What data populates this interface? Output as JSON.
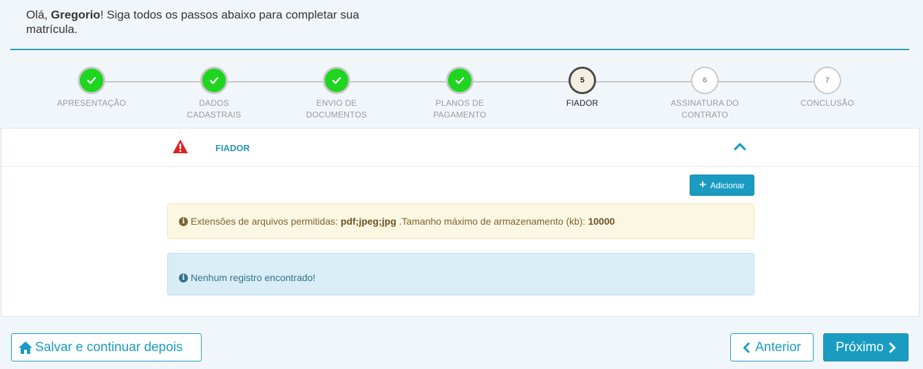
{
  "greeting": {
    "prefix": "Olá, ",
    "name": "Gregorio",
    "suffix": "! Siga todos os passos abaixo para completar sua matrícula."
  },
  "stepper": {
    "steps": [
      {
        "label_line1": "APRESENTAÇÃO",
        "label_line2": "",
        "status": "done",
        "number": ""
      },
      {
        "label_line1": "DADOS",
        "label_line2": "CADASTRAIS",
        "status": "done",
        "number": ""
      },
      {
        "label_line1": "ENVIO DE",
        "label_line2": "DOCUMENTOS",
        "status": "done",
        "number": ""
      },
      {
        "label_line1": "PLANOS DE",
        "label_line2": "PAGAMENTO",
        "status": "done",
        "number": ""
      },
      {
        "label_line1": "FIADOR",
        "label_line2": "",
        "status": "current",
        "number": "5"
      },
      {
        "label_line1": "ASSINATURA DO",
        "label_line2": "CONTRATO",
        "status": "pending",
        "number": "6"
      },
      {
        "label_line1": "CONCLUSÃO",
        "label_line2": "",
        "status": "pending",
        "number": "7"
      }
    ]
  },
  "panel": {
    "title": "FIADOR",
    "add_button_label": "Adicionar",
    "warning": {
      "text_before": "Extensões de arquivos permitidas: ",
      "extensions": "pdf;jpeg;jpg",
      "text_middle": " .Tamanho máximo de armazenamento (kb): ",
      "max_size": "10000"
    },
    "empty_message": "Nenhum registro encontrado!"
  },
  "footer": {
    "save_label": "Salvar e continuar depois",
    "prev_label": "Anterior",
    "next_label": "Próximo"
  },
  "colors": {
    "accent": "#1a9cc2",
    "done": "#1fd51f",
    "warning_icon": "#e02020"
  },
  "icons": [
    "check-icon",
    "warning-triangle-icon",
    "chevron-up-icon",
    "plus-icon",
    "info-circle-icon",
    "home-icon",
    "chevron-left-icon",
    "chevron-right-icon"
  ]
}
